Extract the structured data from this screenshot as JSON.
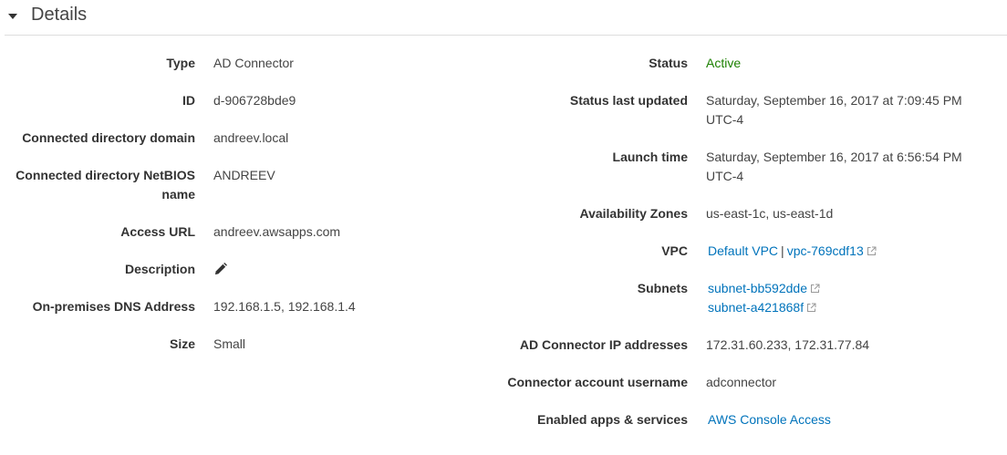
{
  "panel": {
    "title": "Details"
  },
  "left_fields": [
    {
      "label": "Type",
      "value": "AD Connector"
    },
    {
      "label": "ID",
      "value": "d-906728bde9"
    },
    {
      "label": "Connected directory domain",
      "value": "andreev.local"
    },
    {
      "label_line1": "Connected directory NetBIOS",
      "label_line2": "name",
      "value": "ANDREEV"
    },
    {
      "label": "Access URL",
      "value": "andreev.awsapps.com"
    },
    {
      "label": "Description",
      "icon": "pencil-icon"
    },
    {
      "label": "On-premises DNS Address",
      "value": "192.168.1.5, 192.168.1.4"
    },
    {
      "label": "Size",
      "value": "Small"
    }
  ],
  "right_fields": {
    "status": {
      "label": "Status",
      "value": "Active",
      "color": "#1d8102"
    },
    "status_last_updated": {
      "label": "Status last updated",
      "value_line1": "Saturday, September 16, 2017 at 7:09:45 PM",
      "value_line2": "UTC-4"
    },
    "launch_time": {
      "label": "Launch time",
      "value_line1": "Saturday, September 16, 2017 at 6:56:54 PM",
      "value_line2": "UTC-4"
    },
    "availability_zones": {
      "label": "Availability Zones",
      "value": "us-east-1c, us-east-1d"
    },
    "vpc": {
      "label": "VPC",
      "link_text": "Default VPC",
      "separator": "|",
      "link2_text": "vpc-769cdf13",
      "icon": "external-link-icon"
    },
    "subnets": {
      "label": "Subnets",
      "items": [
        "subnet-bb592dde",
        "subnet-a421868f"
      ],
      "icon": "external-link-icon"
    },
    "ad_connector_ip": {
      "label": "AD Connector IP addresses",
      "value": "172.31.60.233, 172.31.77.84"
    },
    "connector_account": {
      "label": "Connector account username",
      "value": "adconnector"
    },
    "enabled_apps": {
      "label": "Enabled apps & services",
      "link_text": "AWS Console Access"
    }
  },
  "colors": {
    "link": "#0073bb",
    "active": "#1d8102",
    "label": "#333333",
    "text": "#444444",
    "divider": "#dddddd"
  }
}
